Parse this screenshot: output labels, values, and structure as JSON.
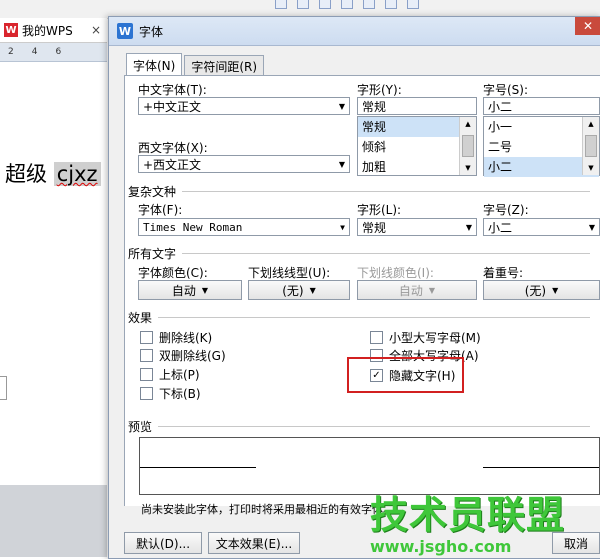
{
  "background": {
    "tab_label": "我的WPS",
    "tab_close": "×",
    "ruler_marks": [
      "2",
      "4",
      "6"
    ],
    "doc_text": "超级",
    "doc_selected": "cjxz"
  },
  "dialog": {
    "title": "字体",
    "close": "✕",
    "tabs": [
      {
        "label": "字体(N)",
        "active": true
      },
      {
        "label": "字符间距(R)",
        "active": false
      }
    ],
    "cn_font": {
      "label": "中文字体(T):",
      "value": "+中文正文"
    },
    "west_font": {
      "label": "西文字体(X):",
      "value": "+西文正文"
    },
    "style": {
      "label": "字形(Y):",
      "value": "常规",
      "options": [
        "常规",
        "倾斜",
        "加粗"
      ]
    },
    "size": {
      "label": "字号(S):",
      "value": "小二",
      "options": [
        "小一",
        "二号",
        "小二"
      ]
    },
    "complex": {
      "section": "复杂文种",
      "font_label": "字体(F):",
      "font_value": "Times New Roman",
      "style_label": "字形(L):",
      "style_value": "常规",
      "size_label": "字号(Z):",
      "size_value": "小二"
    },
    "all_text": {
      "section": "所有文字",
      "color_label": "字体颜色(C):",
      "color_value": "自动",
      "underline_label": "下划线线型(U):",
      "underline_value": "(无)",
      "underline_color_label": "下划线颜色(I):",
      "underline_color_value": "自动",
      "emphasis_label": "着重号:",
      "emphasis_value": "(无)"
    },
    "effects": {
      "section": "效果",
      "strikethrough": "删除线(K)",
      "double_strike": "双删除线(G)",
      "superscript": "上标(P)",
      "subscript": "下标(B)",
      "small_caps": "小型大写字母(M)",
      "all_caps": "全部大写字母(A)",
      "hidden": "隐藏文字(H)",
      "hidden_checked": true
    },
    "preview": {
      "section": "预览",
      "note": "尚未安装此字体，打印时将采用最相近的有效字体。"
    },
    "buttons": {
      "default": "默认(D)...",
      "text_effect": "文本效果(E)...",
      "cancel": "取消"
    },
    "checkmark": "✓",
    "arrow": "▼"
  },
  "watermark": {
    "name": "技术员联盟",
    "url": "www.jsgho.com"
  },
  "colors": {
    "highlight": "#d22020",
    "accent": "#3fc73a"
  }
}
